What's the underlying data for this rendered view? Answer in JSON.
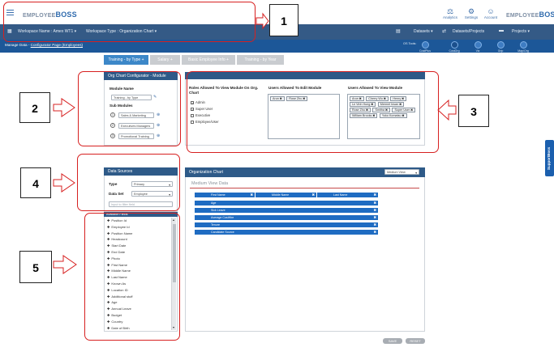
{
  "header": {
    "logo_left": {
      "prefix": "EMPLOYEE",
      "bold": "BOSS"
    },
    "logo_right": {
      "prefix": "EMPLOYEE",
      "bold": "BOSS"
    },
    "icons": [
      {
        "label": "Analytics",
        "icon": "analytics-icon"
      },
      {
        "label": "Settings",
        "icon": "gear-icon"
      },
      {
        "label": "Account",
        "icon": "user-icon"
      }
    ]
  },
  "nav": {
    "workspace": "Workspace Name : Amex WT1 ▾",
    "workspace_type": "Workspace Type : Organization Chart ▾",
    "datasets": "Datasets ▾",
    "datasets_projects": "Datasets/Projects",
    "projects": "Projects ▾"
  },
  "subbar": {
    "crumb_prefix": "Manage Data - ",
    "crumb_link": "Configurator Page (Employees)",
    "org_tools": "OS Tools:",
    "quick_links": [
      "CostPlus",
      "CostOrg",
      "Viz",
      "Grip",
      "Map/Org"
    ]
  },
  "tabs": [
    {
      "label": "Training - by Type",
      "icon": "+"
    },
    {
      "label": "Salary",
      "icon": "+"
    },
    {
      "label": "Basic Employee Info",
      "icon": "+"
    },
    {
      "label": "Training - by Year",
      "icon": ""
    }
  ],
  "module_panel": {
    "title": "Org Chart Configurator - Module",
    "module_name_label": "Module Name",
    "module_name_value": "Training - by Type",
    "sub_modules_label": "Sub Modules",
    "sub_modules": [
      {
        "n": "1",
        "name": "Sales & Marketing"
      },
      {
        "n": "2",
        "name": "Executives Managers"
      },
      {
        "n": "3",
        "name": "Promotional Training"
      }
    ]
  },
  "roles_panel": {
    "roles_label": "Roles Allowed To View Module On Org. Chart",
    "roles": [
      {
        "name": "Admin",
        "checked": true
      },
      {
        "name": "Super User",
        "checked": true
      },
      {
        "name": "Executive",
        "checked": false
      },
      {
        "name": "Employee/User",
        "checked": false
      }
    ],
    "edit_label": "Users Allowed To Edit Module",
    "edit_users": [
      "Arun",
      "Rose Zhu"
    ],
    "view_label": "Users Allowed To View Module",
    "view_users": [
      "Arun",
      "Cherry Wu",
      "Henry",
      "Le Vinh Hung",
      "Mermel Insan",
      "Rose Zhu",
      "Smitha",
      "Super User",
      "William Brooks",
      "Yoko Komatsu"
    ]
  },
  "data_sources": {
    "title": "Data Sources",
    "type_label": "Type",
    "type_value": "Primary",
    "dataset_label": "Data Set",
    "dataset_value": "Employee",
    "filter_placeholder": "Input to filter field",
    "fields_header": "Available Fields",
    "fields": [
      "Position Id",
      "Employee Id",
      "Position Name",
      "Headcount",
      "Start Date",
      "End Date",
      "Photo",
      "First Name",
      "Middle Name",
      "Last Name",
      "Known As",
      "Location ID",
      "Additional stuff",
      "Age",
      "Annual Leave",
      "Budget",
      "Country",
      "Date of Birth"
    ]
  },
  "org_chart": {
    "title": "Organization Chart",
    "view_select": "Medium View",
    "subtitle": "Medium View Data",
    "name_cols": [
      "First Name",
      "Middle Name",
      "Last Name"
    ],
    "rows": [
      "Age",
      "Sick Leave",
      "Average CostHire",
      "Tenure",
      "Candidate Source"
    ]
  },
  "buttons": {
    "save": "SAVE",
    "reset": "RESET"
  },
  "support": "SupportBoss",
  "annotations": [
    "1",
    "2",
    "3",
    "4",
    "5"
  ],
  "colors": {
    "annotation": "#d72020",
    "header_bar": "#345a86",
    "subbar": "#1c5798",
    "panel_head": "#2e5a88",
    "grid_row": "#1f6cc2"
  }
}
